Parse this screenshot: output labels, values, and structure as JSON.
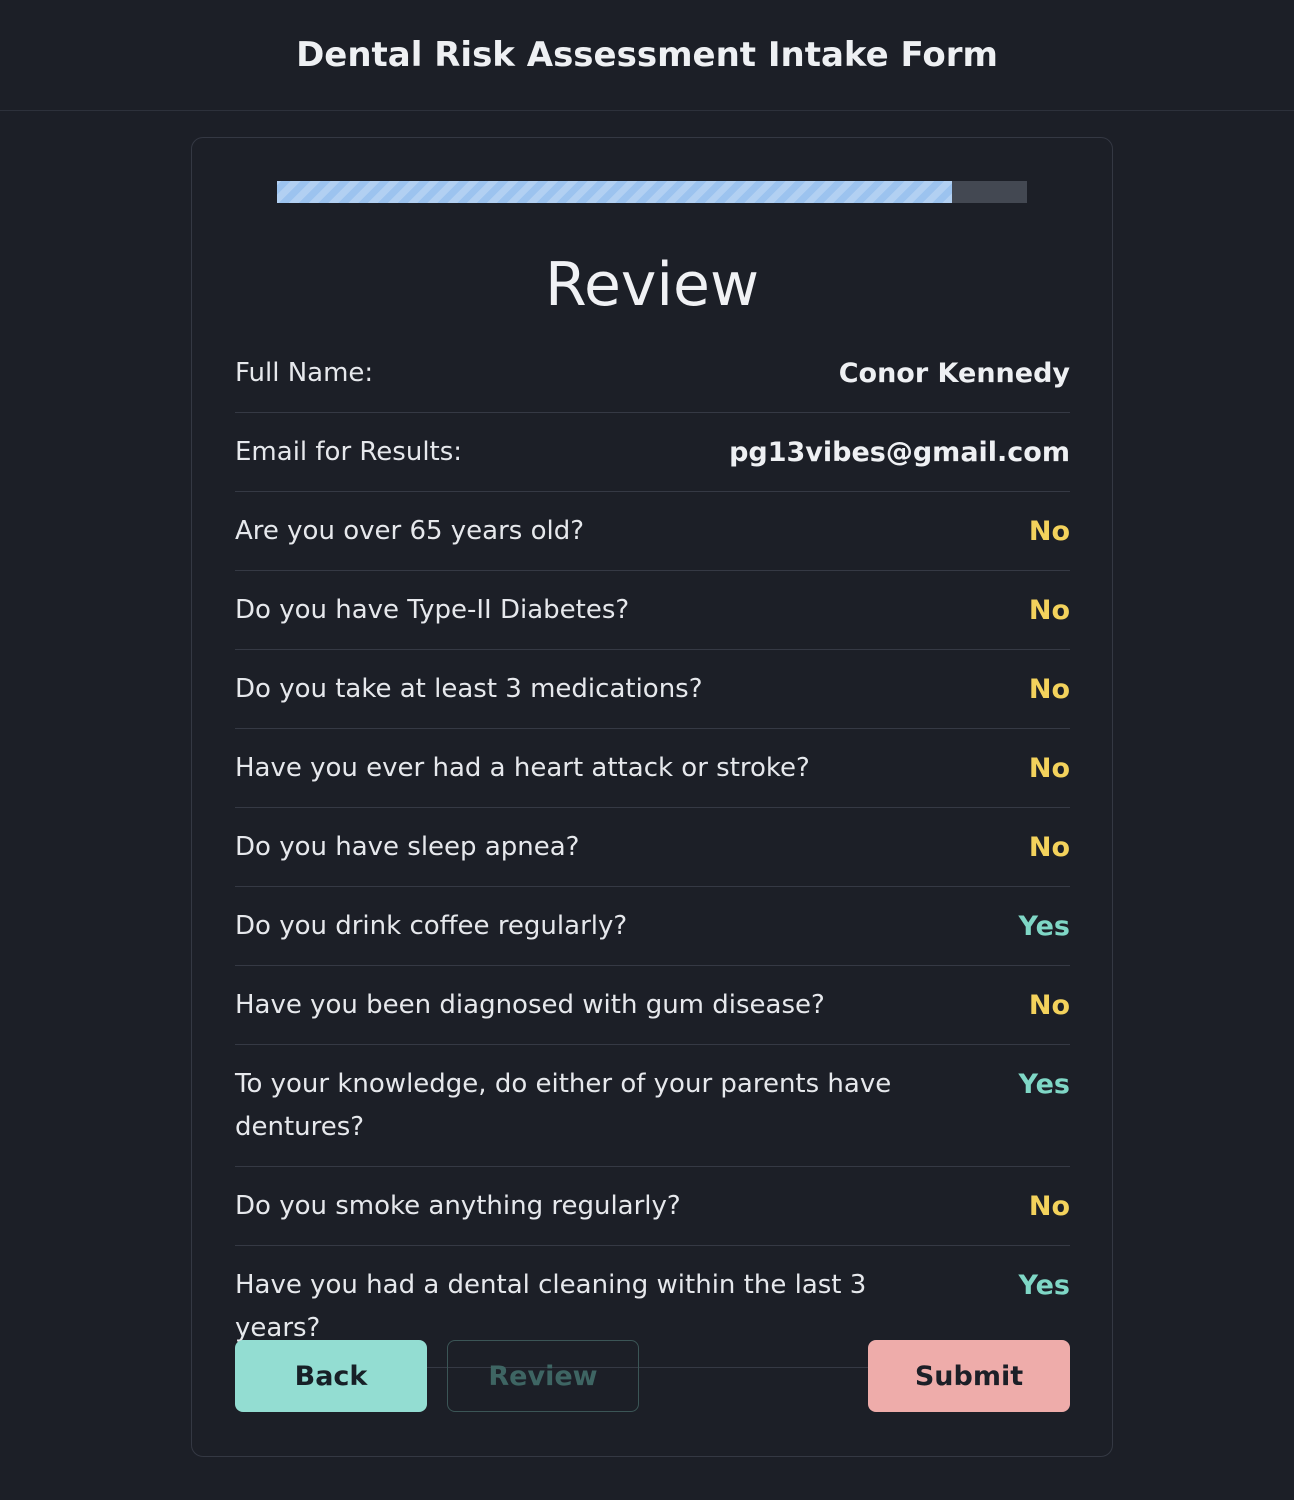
{
  "header": {
    "title": "Dental Risk Assessment Intake Form"
  },
  "progress": {
    "fraction": 0.9
  },
  "review": {
    "heading": "Review",
    "rows": [
      {
        "label": "Full Name:",
        "value": "Conor Kennedy",
        "kind": "plain"
      },
      {
        "label": "Email for Results:",
        "value": "pg13vibes@gmail.com",
        "kind": "plain"
      },
      {
        "label": "Are you over 65 years old?",
        "value": "No",
        "kind": "no"
      },
      {
        "label": "Do you have Type-II Diabetes?",
        "value": "No",
        "kind": "no"
      },
      {
        "label": "Do you take at least 3 medications?",
        "value": "No",
        "kind": "no"
      },
      {
        "label": "Have you ever had a heart attack or stroke?",
        "value": "No",
        "kind": "no"
      },
      {
        "label": "Do you have sleep apnea?",
        "value": "No",
        "kind": "no"
      },
      {
        "label": "Do you drink coffee regularly?",
        "value": "Yes",
        "kind": "yes"
      },
      {
        "label": "Have you been diagnosed with gum disease?",
        "value": "No",
        "kind": "no"
      },
      {
        "label": "To your knowledge, do either of your parents have dentures?",
        "value": "Yes",
        "kind": "yes"
      },
      {
        "label": "Do you smoke anything regularly?",
        "value": "No",
        "kind": "no"
      },
      {
        "label": "Have you had a dental cleaning within the last 3 years?",
        "value": "Yes",
        "kind": "yes"
      }
    ]
  },
  "actions": {
    "back_label": "Back",
    "review_label": "Review",
    "submit_label": "Submit"
  },
  "colors": {
    "background": "#1c1f27",
    "progress_fill": "#9cc3ef",
    "progress_track": "#434852",
    "answer_no": "#f3d25c",
    "answer_yes": "#7fd7c6",
    "back_button": "#93ddd2",
    "submit_button": "#eeacaa"
  }
}
